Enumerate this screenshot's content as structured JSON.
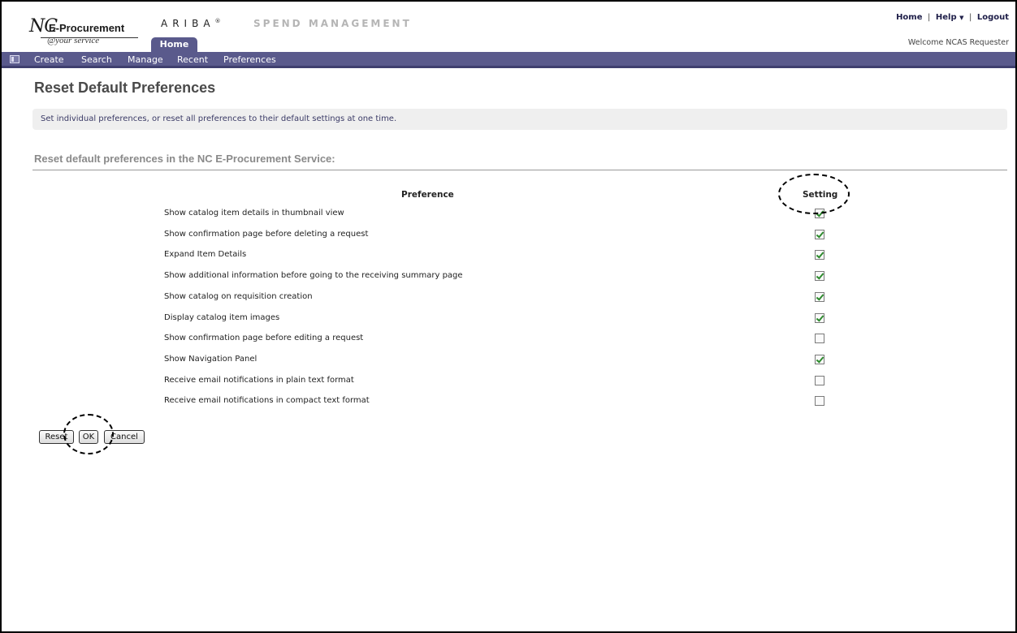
{
  "header": {
    "logo_nc": "NC",
    "logo_name": "E-Procurement",
    "logo_tagline": "@your service",
    "brand": "ARIBA",
    "brand_reg": "®",
    "brand_sub": "SPEND MANAGEMENT",
    "tab_home": "Home",
    "links": {
      "home": "Home",
      "help": "Help",
      "logout": "Logout"
    },
    "welcome": "Welcome NCAS Requester"
  },
  "nav": {
    "items": [
      {
        "label": "Create"
      },
      {
        "label": "Search"
      },
      {
        "label": "Manage"
      },
      {
        "label": "Recent"
      },
      {
        "label": "Preferences"
      }
    ]
  },
  "main": {
    "title": "Reset Default Preferences",
    "info": "Set individual preferences, or reset all preferences to their default settings at one time.",
    "section_title": "Reset default preferences in the NC E-Procurement Service:",
    "columns": {
      "preference": "Preference",
      "setting": "Setting"
    },
    "preferences": [
      {
        "label": "Show catalog item details in thumbnail view",
        "checked": true
      },
      {
        "label": "Show confirmation page before deleting a request",
        "checked": true
      },
      {
        "label": "Expand Item Details",
        "checked": true
      },
      {
        "label": "Show additional information before going to the receiving summary page",
        "checked": true
      },
      {
        "label": "Show catalog on requisition creation",
        "checked": true
      },
      {
        "label": "Display catalog item images",
        "checked": true
      },
      {
        "label": "Show confirmation page before editing a request",
        "checked": false
      },
      {
        "label": "Show Navigation Panel",
        "checked": true
      },
      {
        "label": "Receive email notifications in plain text format",
        "checked": false
      },
      {
        "label": "Receive email notifications in compact text format",
        "checked": false
      }
    ],
    "buttons": {
      "reset": "Reset",
      "ok": "OK",
      "cancel": "Cancel"
    }
  }
}
